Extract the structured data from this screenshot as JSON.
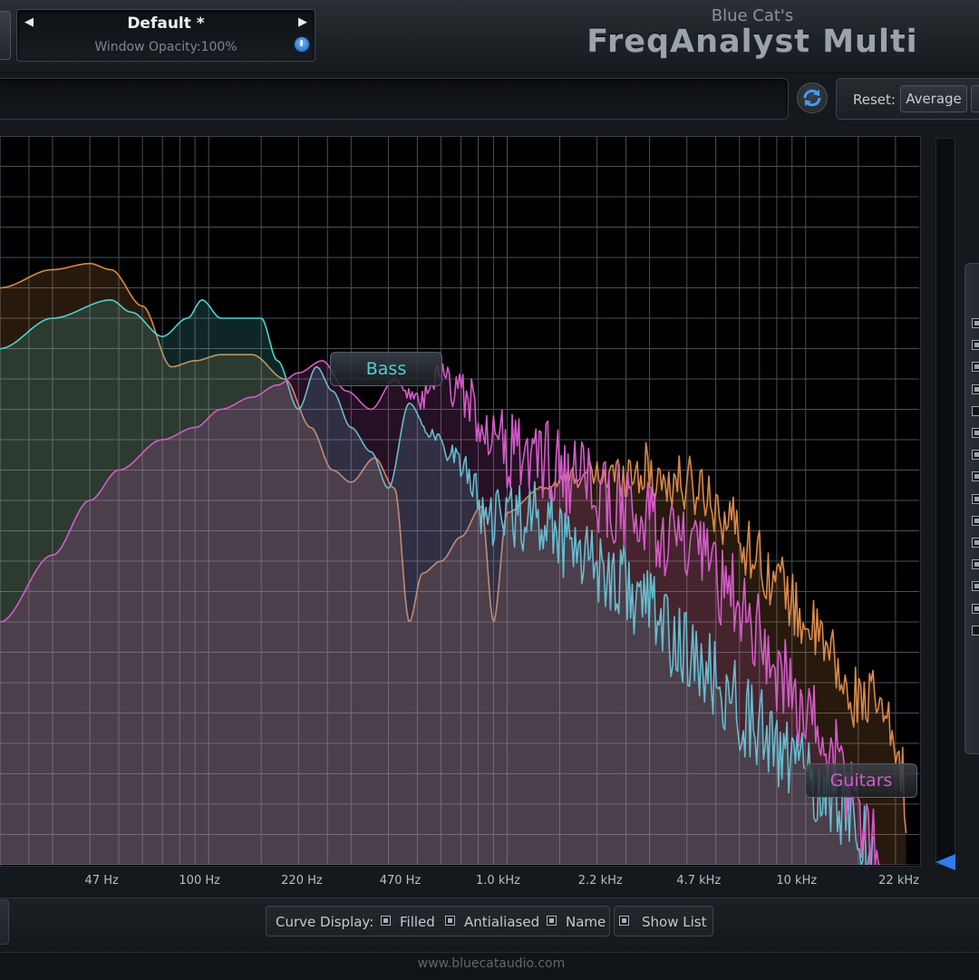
{
  "window": {
    "brand_small": "Blue Cat's",
    "brand_title": "FreqAnalyst Multi"
  },
  "preset": {
    "name": "Default *",
    "window_opacity": "Window Opacity:100%",
    "prev_icon": "triangle-left-icon",
    "next_icon": "triangle-right-icon"
  },
  "toolbar": {
    "refresh_icon": "refresh-icon",
    "reset_label": "Reset:",
    "reset_average": "Average"
  },
  "graph": {
    "x_axis": {
      "scale": "log",
      "range_hz": [
        20,
        24000
      ],
      "ticks": [
        {
          "label": "47 Hz",
          "hz": 47
        },
        {
          "label": "100 Hz",
          "hz": 100
        },
        {
          "label": "220 Hz",
          "hz": 220
        },
        {
          "label": "470 Hz",
          "hz": 470
        },
        {
          "label": "1.0 kHz",
          "hz": 1000
        },
        {
          "label": "2.2 kHz",
          "hz": 2200
        },
        {
          "label": "4.7 kHz",
          "hz": 4700
        },
        {
          "label": "10 kHz",
          "hz": 10000
        },
        {
          "label": "22 kHz",
          "hz": 22000
        }
      ]
    },
    "y_axis": {
      "range_db": [
        -120,
        0
      ]
    },
    "grid": true,
    "curves": [
      {
        "name": "",
        "color": "#d9884a",
        "shape": "smooth",
        "points": [
          [
            20,
            -25
          ],
          [
            30,
            -22
          ],
          [
            40,
            -21
          ],
          [
            47,
            -22
          ],
          [
            60,
            -28
          ],
          [
            75,
            -38
          ],
          [
            90,
            -37
          ],
          [
            110,
            -36
          ],
          [
            140,
            -36
          ],
          [
            180,
            -40
          ],
          [
            220,
            -48
          ],
          [
            260,
            -55
          ],
          [
            300,
            -57
          ],
          [
            360,
            -53
          ],
          [
            420,
            -58
          ],
          [
            470,
            -80
          ],
          [
            520,
            -72
          ],
          [
            600,
            -70
          ],
          [
            700,
            -66
          ],
          [
            820,
            -61
          ],
          [
            900,
            -80
          ],
          [
            1000,
            -62
          ],
          [
            1300,
            -58
          ],
          [
            1700,
            -56
          ],
          [
            2200,
            -56
          ],
          [
            2800,
            -55
          ],
          [
            3500,
            -57
          ],
          [
            4500,
            -58
          ],
          [
            5500,
            -63
          ],
          [
            6500,
            -68
          ],
          [
            8000,
            -73
          ],
          [
            10000,
            -80
          ],
          [
            12000,
            -85
          ],
          [
            14000,
            -93
          ],
          [
            15000,
            -92
          ],
          [
            17000,
            -93
          ],
          [
            19000,
            -98
          ],
          [
            21000,
            -104
          ],
          [
            22000,
            -120
          ]
        ],
        "noise_from_hz": 1200,
        "noise_db": 5
      },
      {
        "name": "Bass",
        "color": "#4fd2d0",
        "shape": "smooth",
        "points": [
          [
            20,
            -35
          ],
          [
            30,
            -30
          ],
          [
            47,
            -27
          ],
          [
            55,
            -29
          ],
          [
            70,
            -33
          ],
          [
            85,
            -30
          ],
          [
            95,
            -27
          ],
          [
            110,
            -30
          ],
          [
            130,
            -30
          ],
          [
            150,
            -30
          ],
          [
            170,
            -37
          ],
          [
            200,
            -45
          ],
          [
            230,
            -38
          ],
          [
            260,
            -42
          ],
          [
            300,
            -48
          ],
          [
            350,
            -52
          ],
          [
            400,
            -58
          ],
          [
            470,
            -44
          ],
          [
            550,
            -49
          ],
          [
            650,
            -52
          ],
          [
            750,
            -56
          ],
          [
            850,
            -64
          ],
          [
            1000,
            -62
          ],
          [
            1300,
            -63
          ],
          [
            1700,
            -67
          ],
          [
            2200,
            -72
          ],
          [
            2800,
            -76
          ],
          [
            3500,
            -82
          ],
          [
            4500,
            -88
          ],
          [
            5500,
            -92
          ],
          [
            6500,
            -96
          ],
          [
            8000,
            -101
          ],
          [
            9500,
            -104
          ],
          [
            11000,
            -107
          ],
          [
            13000,
            -110
          ],
          [
            15000,
            -114
          ],
          [
            17000,
            -120
          ]
        ],
        "noise_from_hz": 500,
        "noise_db": 7
      },
      {
        "name": "Guitars",
        "color": "#d45bc8",
        "shape": "smooth",
        "points": [
          [
            20,
            -80
          ],
          [
            30,
            -69
          ],
          [
            40,
            -60
          ],
          [
            50,
            -55
          ],
          [
            70,
            -50
          ],
          [
            90,
            -48
          ],
          [
            110,
            -45
          ],
          [
            140,
            -43
          ],
          [
            170,
            -41
          ],
          [
            200,
            -39
          ],
          [
            240,
            -37
          ],
          [
            290,
            -42
          ],
          [
            350,
            -45
          ],
          [
            420,
            -40
          ],
          [
            500,
            -44
          ],
          [
            600,
            -40
          ],
          [
            700,
            -42
          ],
          [
            800,
            -46
          ],
          [
            1000,
            -52
          ],
          [
            1300,
            -53
          ],
          [
            1700,
            -57
          ],
          [
            2200,
            -60
          ],
          [
            2800,
            -63
          ],
          [
            3500,
            -66
          ],
          [
            4500,
            -70
          ],
          [
            5500,
            -75
          ],
          [
            6500,
            -80
          ],
          [
            8000,
            -88
          ],
          [
            10000,
            -95
          ],
          [
            12000,
            -101
          ],
          [
            14000,
            -107
          ],
          [
            16000,
            -114
          ],
          [
            18000,
            -120
          ]
        ],
        "noise_from_hz": 400,
        "noise_db": 7
      }
    ],
    "tags": {
      "bass": "Bass",
      "guitars": "Guitars"
    }
  },
  "list_panel": {
    "checks": [
      true,
      true,
      true,
      true,
      false,
      true,
      true,
      true,
      true,
      true,
      true,
      true,
      true,
      true,
      false
    ]
  },
  "bottom_bar": {
    "curve_display_label": "Curve Display:",
    "filled": "Filled",
    "antialiased": "Antialiased",
    "name": "Name",
    "show_list": "Show List"
  },
  "footer": {
    "url": "www.bluecataudio.com"
  }
}
